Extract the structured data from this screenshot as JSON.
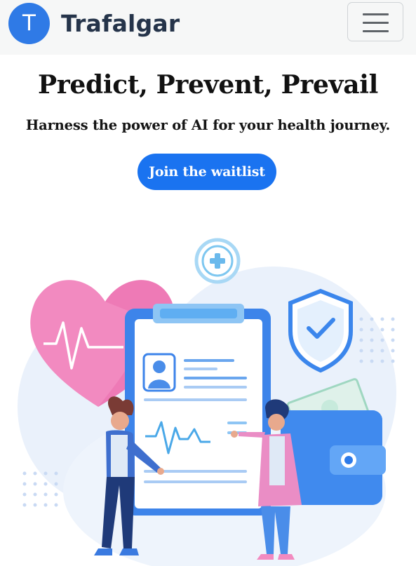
{
  "header": {
    "logo_letter": "T",
    "brand_name": "Trafalgar",
    "menu_icon": "hamburger-menu-icon"
  },
  "hero": {
    "title": "Predict, Prevent, Prevail",
    "subtitle": "Harness the power of AI for your health journey.",
    "cta_label": "Join the waitlist"
  },
  "colors": {
    "brand_blue": "#2f7ae6",
    "cta_blue": "#1a73f0",
    "nav_bg": "#f6f7f7",
    "heart_pink": "#f28ac0"
  },
  "illustration": {
    "icons": [
      "medical-plus-icon",
      "heart-pulse-icon",
      "shield-check-icon",
      "clipboard-icon",
      "wallet-icon",
      "cash-icon"
    ]
  }
}
